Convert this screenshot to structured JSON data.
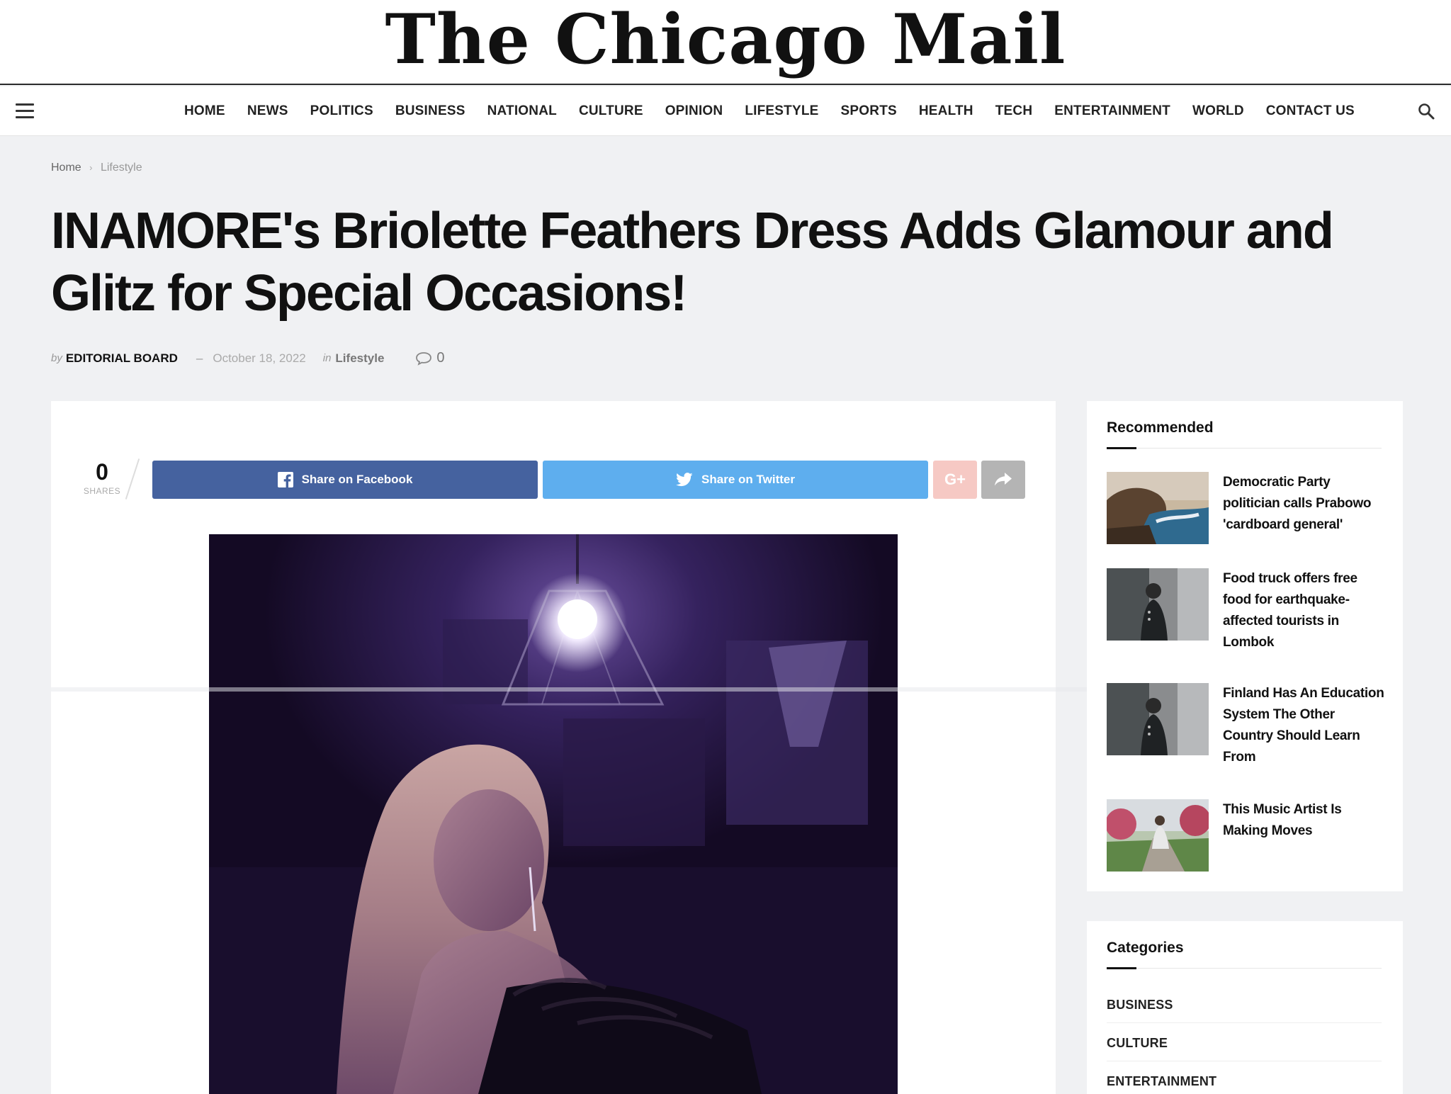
{
  "masthead": {
    "logo_text": "The Chicago Mail"
  },
  "nav": {
    "items": [
      "HOME",
      "NEWS",
      "POLITICS",
      "BUSINESS",
      "NATIONAL",
      "CULTURE",
      "OPINION",
      "LIFESTYLE",
      "SPORTS",
      "HEALTH",
      "TECH",
      "ENTERTAINMENT",
      "WORLD",
      "CONTACT US"
    ],
    "menu_icon": "hamburger-icon",
    "search_icon": "search-icon"
  },
  "breadcrumb": {
    "home": "Home",
    "current": "Lifestyle"
  },
  "article": {
    "title": "INAMORE's Briolette Feathers Dress Adds Glamour and Glitz for Special Occasions!",
    "by_label": "by",
    "author": "EDITORIAL BOARD",
    "dash": "–",
    "date": "October 18, 2022",
    "in_label": "in",
    "category": "Lifestyle",
    "comment_count": "0"
  },
  "share": {
    "count": "0",
    "count_label": "SHARES",
    "facebook_label": "Share on Facebook",
    "twitter_label": "Share on Twitter",
    "googleplus_label": "G+",
    "colors": {
      "facebook": "#45629f",
      "twitter": "#5eaeee",
      "googleplus": "#f6c9c4",
      "more": "#b4b4b4"
    }
  },
  "sidebar": {
    "recommended": {
      "title": "Recommended",
      "items": [
        {
          "title": "Democratic Party politician calls Prabowo 'cardboard general'",
          "thumb": "coastal-rocks-photo"
        },
        {
          "title": "Food truck offers free food for earthquake-affected tourists in Lombok",
          "thumb": "man-in-coat-photo"
        },
        {
          "title": "Finland Has An Education System The Other Country Should Learn From",
          "thumb": "man-in-coat-photo"
        },
        {
          "title": "This Music Artist Is Making Moves",
          "thumb": "woman-on-path-photo"
        }
      ]
    },
    "categories": {
      "title": "Categories",
      "items": [
        "BUSINESS",
        "CULTURE",
        "ENTERTAINMENT"
      ]
    }
  }
}
